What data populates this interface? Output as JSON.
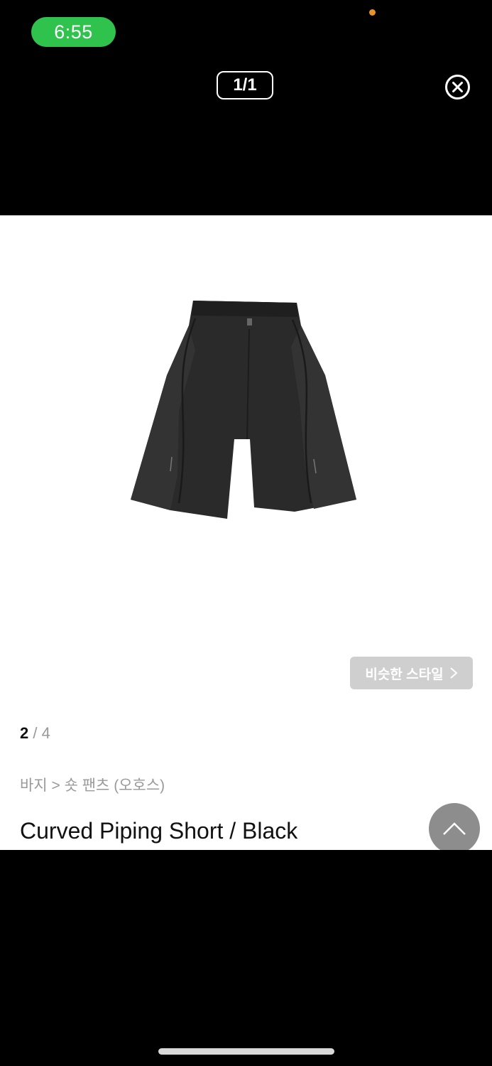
{
  "status_bar": {
    "time": "6:55",
    "accent_color": "#2fc24d"
  },
  "viewer": {
    "page_counter": "1/1",
    "close_icon": "close-circle-icon"
  },
  "product": {
    "image_alt": "black curved piping shorts",
    "similar_style_label": "비슷한 스타일",
    "image_index": {
      "current": "2",
      "separator": " / ",
      "total": "4"
    },
    "breadcrumb": "바지 > 숏 팬츠 (오호스)",
    "title": "Curved Piping Short / Black"
  },
  "scroll_top_icon": "chevron-up-icon"
}
